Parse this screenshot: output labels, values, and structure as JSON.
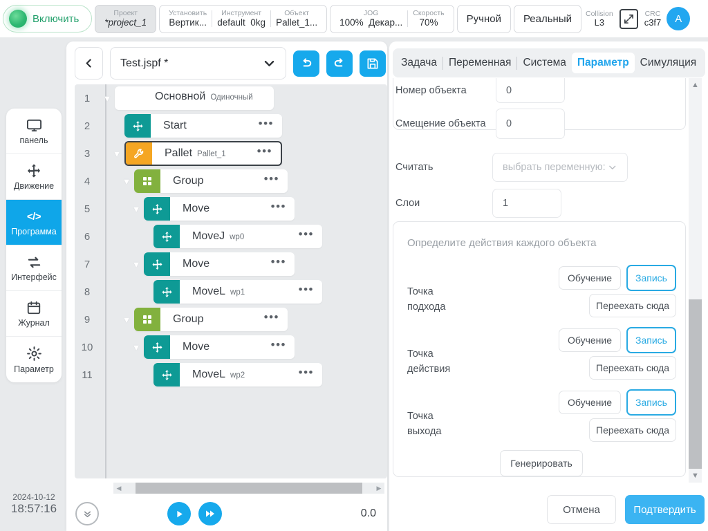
{
  "topbar": {
    "power": {
      "label": "Включить",
      "state_color": "#22a06b"
    },
    "project": {
      "key": "Проект",
      "value": "*project_1"
    },
    "install": {
      "key": "Установить",
      "value": "Вертик..."
    },
    "tool": {
      "key": "Инструмент",
      "value": "default",
      "payload": "0kg"
    },
    "object": {
      "key": "Объект",
      "value": "Pallet_1..."
    },
    "jog": {
      "key": "JOG",
      "value": "100%",
      "mode": "Декар..."
    },
    "speed": {
      "key": "Скорость",
      "value": "70%"
    },
    "mode_manual": "Ручной",
    "mode_real": "Реальный",
    "collision": {
      "key": "Collision",
      "value": "L3"
    },
    "expand_icon": "expand-arrows-icon",
    "crc": {
      "key": "CRC",
      "value": "c3f7"
    },
    "avatar": "A",
    "accent": "#22a7f0"
  },
  "sidebar": {
    "items": [
      {
        "label": "панель",
        "icon": "monitor-icon",
        "active": false
      },
      {
        "label": "Движение",
        "icon": "move-arrows-icon",
        "active": false
      },
      {
        "label": "Программа",
        "icon": "code-icon",
        "active": true
      },
      {
        "label": "Интерфейс",
        "icon": "sync-arrows-icon",
        "active": false
      },
      {
        "label": "Журнал",
        "icon": "calendar-icon",
        "active": false
      },
      {
        "label": "Параметр",
        "icon": "gear-icon",
        "active": false
      }
    ],
    "active_color": "#0fa6e9",
    "clock": {
      "date": "2024-10-12",
      "time": "18:57:16"
    }
  },
  "program": {
    "back_icon": "chevron-left-icon",
    "file_name": "Test.jspf *",
    "dropdown_icon": "chevron-down-icon",
    "actions": [
      {
        "name": "undo-button",
        "icon": "undo-icon"
      },
      {
        "name": "redo-button",
        "icon": "redo-icon"
      },
      {
        "name": "save-button",
        "icon": "save-icon"
      }
    ],
    "tree": [
      {
        "line": "1",
        "title": "Основной",
        "sub": "Одиночный",
        "indent": 0,
        "caret": true,
        "icon": null,
        "color": null,
        "selected": false,
        "dots": false
      },
      {
        "line": "2",
        "title": "Start",
        "sub": "",
        "indent": 1,
        "caret": false,
        "icon": "move-arrows-icon",
        "color": "teal",
        "selected": false,
        "dots": true
      },
      {
        "line": "3",
        "title": "Pallet",
        "sub": "Pallet_1",
        "indent": 1,
        "caret": true,
        "icon": "wrench-icon",
        "color": "orange",
        "selected": true,
        "dots": true
      },
      {
        "line": "4",
        "title": "Group",
        "sub": "",
        "indent": 2,
        "caret": true,
        "icon": "grid-icon",
        "color": "green",
        "selected": false,
        "dots": true
      },
      {
        "line": "5",
        "title": "Move",
        "sub": "",
        "indent": 3,
        "caret": true,
        "icon": "move-arrows-icon",
        "color": "teal",
        "selected": false,
        "dots": true
      },
      {
        "line": "6",
        "title": "MoveJ",
        "sub": "wp0",
        "indent": 4,
        "caret": false,
        "icon": "move-arrows-icon",
        "color": "teal",
        "selected": false,
        "dots": true
      },
      {
        "line": "7",
        "title": "Move",
        "sub": "",
        "indent": 3,
        "caret": true,
        "icon": "move-arrows-icon",
        "color": "teal",
        "selected": false,
        "dots": true
      },
      {
        "line": "8",
        "title": "MoveL",
        "sub": "wp1",
        "indent": 4,
        "caret": false,
        "icon": "move-arrows-icon",
        "color": "teal",
        "selected": false,
        "dots": true
      },
      {
        "line": "9",
        "title": "Group",
        "sub": "",
        "indent": 2,
        "caret": true,
        "icon": "grid-icon",
        "color": "green",
        "selected": false,
        "dots": true
      },
      {
        "line": "10",
        "title": "Move",
        "sub": "",
        "indent": 3,
        "caret": true,
        "icon": "move-arrows-icon",
        "color": "teal",
        "selected": false,
        "dots": true
      },
      {
        "line": "11",
        "title": "MoveL",
        "sub": "wp2",
        "indent": 4,
        "caret": false,
        "icon": "move-arrows-icon",
        "color": "teal",
        "selected": false,
        "dots": true
      }
    ],
    "bottom": {
      "collapse_icon": "chevron-double-down-icon",
      "play_icon": "play-icon",
      "step_icon": "fast-forward-icon",
      "speed_value": "0.0"
    }
  },
  "right": {
    "tabs": [
      {
        "label": "Задача",
        "active": false
      },
      {
        "label": "Переменная",
        "active": false
      },
      {
        "label": "Система",
        "active": false
      },
      {
        "label": "Параметр",
        "active": true
      },
      {
        "label": "Симуляция",
        "active": false
      }
    ],
    "tab_active_color": "#1fa4ec",
    "fields": [
      {
        "label": "Номер объекта",
        "value": "0"
      },
      {
        "label": "Смещение объекта",
        "value": "0"
      }
    ],
    "count_field": {
      "label": "Считать",
      "placeholder": "выбрать переменную: п",
      "icon": "chevron-down-icon"
    },
    "layers_field": {
      "label": "Слои",
      "value": "1"
    },
    "actions_box": {
      "hint": "Определите действия каждого объекта",
      "generate_label": "Генерировать",
      "points": [
        {
          "label_line1": "Точка",
          "label_line2": "подхода",
          "teach": "Обучение",
          "record": "Запись",
          "moveto": "Переехать сюда"
        },
        {
          "label_line1": "Точка",
          "label_line2": "действия",
          "teach": "Обучение",
          "record": "Запись",
          "moveto": "Переехать сюда"
        },
        {
          "label_line1": "Точка",
          "label_line2": "выхода",
          "teach": "Обучение",
          "record": "Запись",
          "moveto": "Переехать сюда"
        }
      ]
    },
    "footer": {
      "cancel": "Отмена",
      "confirm": "Подтвердить",
      "confirm_color": "#3bb4f2"
    }
  }
}
